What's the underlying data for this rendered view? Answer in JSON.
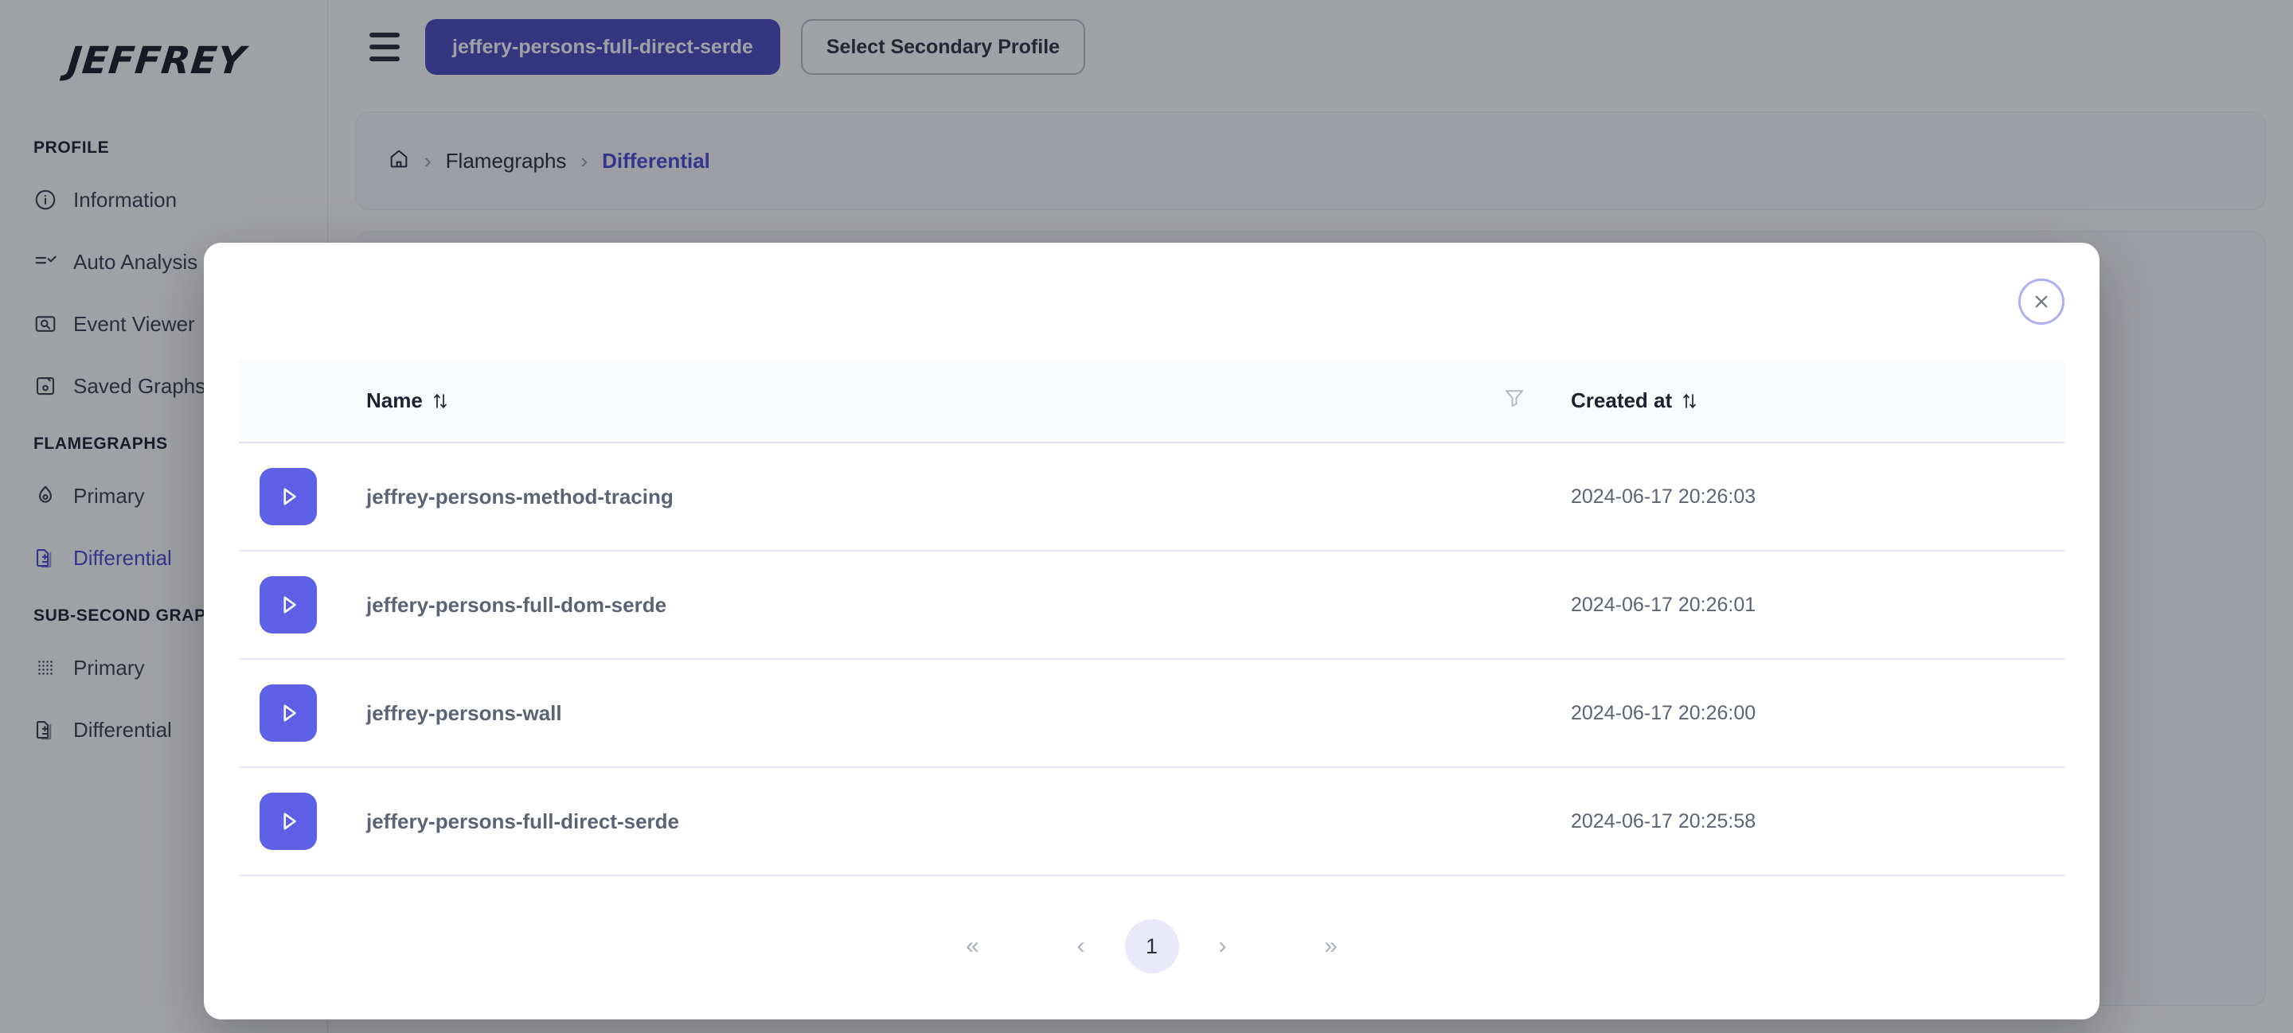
{
  "brand": {
    "name": "JEFFREY"
  },
  "sidebar": {
    "sections": [
      {
        "title": "PROFILE",
        "items": [
          {
            "label": "Information",
            "icon": "info-circle-icon",
            "active": false
          },
          {
            "label": "Auto Analysis",
            "icon": "list-check-icon",
            "active": false
          },
          {
            "label": "Event Viewer",
            "icon": "image-search-icon",
            "active": false
          },
          {
            "label": "Saved Graphs",
            "icon": "save-disk-icon",
            "active": false
          }
        ]
      },
      {
        "title": "FLAMEGRAPHS",
        "items": [
          {
            "label": "Primary",
            "icon": "flame-icon",
            "active": false
          },
          {
            "label": "Differential",
            "icon": "diff-document-icon",
            "active": true
          }
        ]
      },
      {
        "title": "SUB-SECOND GRAPHS",
        "items": [
          {
            "label": "Primary",
            "icon": "dot-grid-icon",
            "active": false
          },
          {
            "label": "Differential",
            "icon": "diff-document-icon",
            "active": false
          }
        ]
      }
    ]
  },
  "topbar": {
    "menu_icon": "hamburger-icon",
    "primary_profile_label": "jeffery-persons-full-direct-serde",
    "secondary_profile_label": "Select Secondary Profile"
  },
  "breadcrumb": {
    "home_icon": "home-icon",
    "separator": "›",
    "items": [
      {
        "label": "Flamegraphs",
        "current": false
      },
      {
        "label": "Differential",
        "current": true
      }
    ]
  },
  "modal": {
    "close_icon": "close-icon",
    "table": {
      "columns": {
        "action": "",
        "name": "Name",
        "filter_icon": "filter-icon",
        "created_at": "Created at"
      },
      "sort_indicator": "↑↓",
      "rows": [
        {
          "action_icon": "play-icon",
          "name": "jeffrey-persons-method-tracing",
          "created_at": "2024-06-17 20:26:03"
        },
        {
          "action_icon": "play-icon",
          "name": "jeffery-persons-full-dom-serde",
          "created_at": "2024-06-17 20:26:01"
        },
        {
          "action_icon": "play-icon",
          "name": "jeffrey-persons-wall",
          "created_at": "2024-06-17 20:26:00"
        },
        {
          "action_icon": "play-icon",
          "name": "jeffery-persons-full-direct-serde",
          "created_at": "2024-06-17 20:25:58"
        }
      ]
    },
    "pagination": {
      "first": "«",
      "prev": "‹",
      "current_page": "1",
      "next": "›",
      "last": "»"
    }
  },
  "colors": {
    "accent": "#4b4ddb",
    "primary_button": "#4b4dc4",
    "play_button": "#5e60e8",
    "page_active_bg": "#e9e9fa",
    "close_ring": "#aeaff0"
  }
}
